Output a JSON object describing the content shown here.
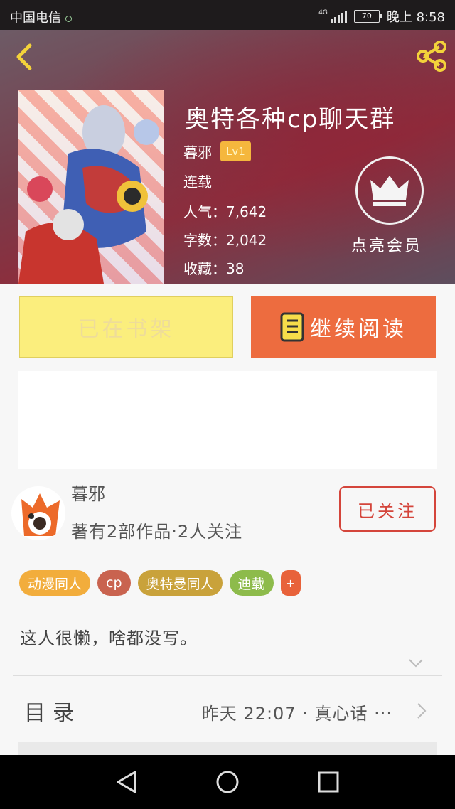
{
  "status_bar": {
    "carrier": "中国电信",
    "network": "4G",
    "battery": "70",
    "time": "晚上 8:58"
  },
  "book": {
    "title": "奥特各种cp聊天群",
    "author": "暮邪",
    "level": "Lv1",
    "status": "连载",
    "popularity_label": "人气：",
    "popularity": "7,642",
    "wordcount_label": "字数：",
    "wordcount": "2,042",
    "favorites_label": "收藏：",
    "favorites": "38"
  },
  "vip": {
    "label": "点亮会员"
  },
  "buttons": {
    "shelf": "已在书架",
    "read": "继续阅读"
  },
  "author_info": {
    "name": "暮邪",
    "stats": "著有2部作品·2人关注",
    "follow_label": "已关注"
  },
  "tags": [
    {
      "label": "动漫同人",
      "color": "#f2ad3c"
    },
    {
      "label": "cp",
      "color": "#c9634f"
    },
    {
      "label": "奥特曼同人",
      "color": "#c9a23b"
    },
    {
      "label": "迪载",
      "color": "#8dbb4b"
    },
    {
      "label": "+",
      "color": "#e8623a"
    }
  ],
  "description": "这人很懒，啥都没写。",
  "toc": {
    "label": "目录",
    "latest": "昨天 22:07 · 真心话 ···"
  },
  "icons": {
    "back": "back-chevron-icon",
    "share": "share-icon",
    "vip": "crown-icon",
    "read": "book-icon",
    "expand": "chevron-down-icon",
    "toc": "chevron-right-icon",
    "nav": [
      "back-triangle-icon",
      "home-circle-icon",
      "recent-square-icon"
    ]
  },
  "colors": {
    "accent_orange": "#ed6c3f",
    "shelf_yellow": "#fbee7d",
    "follow_red": "#d4453b",
    "icon_yellow": "#f3d23a"
  }
}
